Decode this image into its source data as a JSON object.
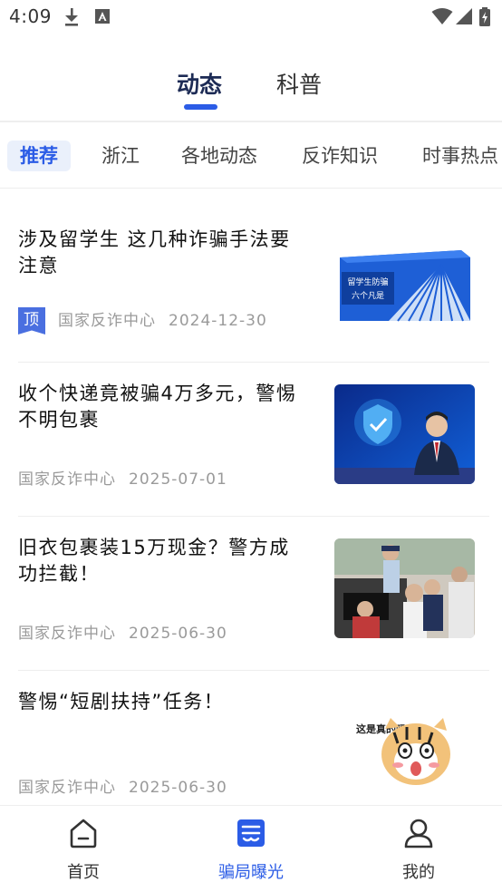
{
  "status_bar": {
    "time": "4:09",
    "left_icons": [
      "download-icon",
      "a-icon"
    ],
    "right_icons": [
      "wifi-icon",
      "signal-icon",
      "battery-icon"
    ]
  },
  "top_tabs": [
    {
      "label": "动态",
      "active": true
    },
    {
      "label": "科普",
      "active": false
    }
  ],
  "categories": [
    {
      "label": "推荐",
      "active": true
    },
    {
      "label": "浙江",
      "active": false
    },
    {
      "label": "各地动态",
      "active": false
    },
    {
      "label": "反诈知识",
      "active": false
    },
    {
      "label": "时事热点",
      "active": false
    }
  ],
  "articles": [
    {
      "title": "涉及留学生 这几种诈骗手法要注意",
      "pinned": true,
      "pin_label": "顶",
      "source": "国家反诈中心",
      "date": "2024-12-30",
      "thumb_text_1": "留学生防骗",
      "thumb_text_2": "六个凡是"
    },
    {
      "title": "收个快递竟被骗4万多元，警惕不明包裹",
      "pinned": false,
      "source": "国家反诈中心",
      "date": "2025-07-01"
    },
    {
      "title": "旧衣包裹装15万现金？警方成功拦截！",
      "pinned": false,
      "source": "国家反诈中心",
      "date": "2025-06-30"
    },
    {
      "title": "警惕“短剧扶持”任务！",
      "pinned": false,
      "source": "国家反诈中心",
      "date": "2025-06-30",
      "thumb_text_1": "这是真的吗"
    }
  ],
  "bottom_nav": [
    {
      "label": "首页",
      "icon": "home-icon",
      "active": false
    },
    {
      "label": "骗局曝光",
      "icon": "exposure-icon",
      "active": true
    },
    {
      "label": "我的",
      "icon": "profile-icon",
      "active": false
    }
  ],
  "colors": {
    "accent": "#2b5ce6",
    "pin_badge": "#4a6fe0",
    "meta_text": "#9a9a9a",
    "active_tab_text": "#1d2b55"
  }
}
